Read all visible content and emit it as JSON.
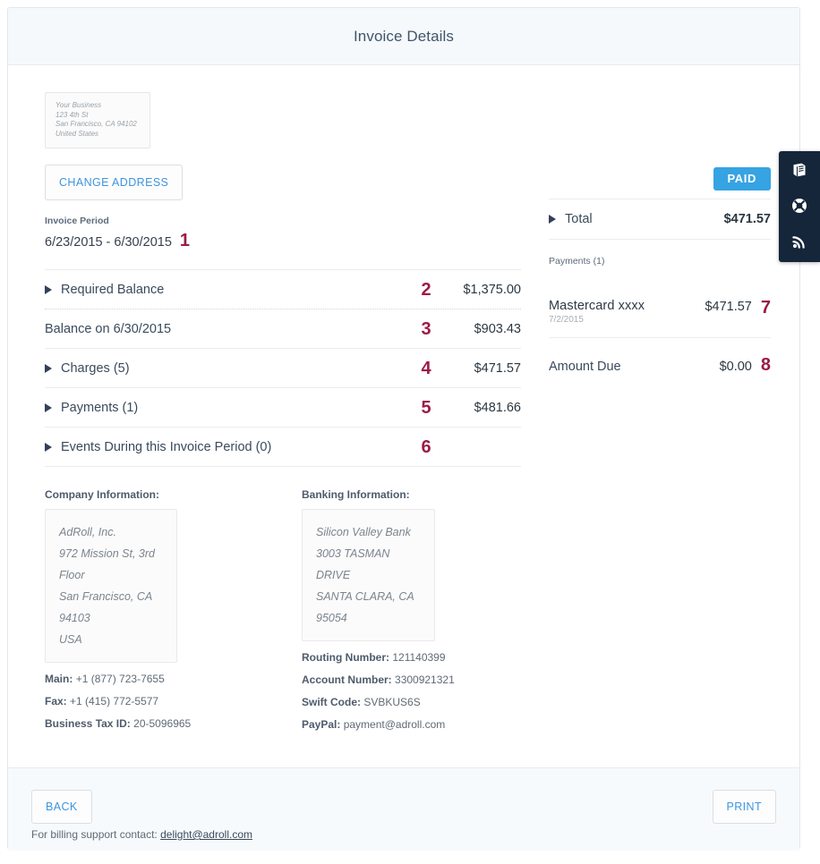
{
  "header": {
    "title": "Invoice Details"
  },
  "your_address": {
    "lines": [
      "Your Business",
      "123 4th St",
      "San Francisco, CA 94102",
      "United States"
    ],
    "change_button": "CHANGE ADDRESS"
  },
  "invoice_period": {
    "label": "Invoice Period",
    "value": "6/23/2015 - 6/30/2015",
    "annotation": "1"
  },
  "line_items": [
    {
      "label": "Required Balance",
      "amount": "$1,375.00",
      "annotation": "2",
      "caret": true,
      "divider": "dotted"
    },
    {
      "label": "Balance on 6/30/2015",
      "amount": "$903.43",
      "annotation": "3",
      "caret": false,
      "divider": "solid"
    },
    {
      "label": "Charges (5)",
      "amount": "$471.57",
      "annotation": "4",
      "caret": true,
      "divider": "solid"
    },
    {
      "label": "Payments (1)",
      "amount": "$481.66",
      "annotation": "5",
      "caret": true,
      "divider": "solid"
    },
    {
      "label": "Events During this Invoice Period (0)",
      "amount": "",
      "annotation": "6",
      "caret": true,
      "divider": "solid"
    }
  ],
  "company_information": {
    "title": "Company Information:",
    "address": [
      "AdRoll, Inc.",
      "972 Mission St, 3rd Floor",
      "San Francisco, CA 94103",
      "USA"
    ],
    "details": [
      {
        "key": "Main:",
        "value": "+1 (877) 723-7655"
      },
      {
        "key": "Fax:",
        "value": "+1 (415) 772-5577"
      },
      {
        "key": "Business Tax ID:",
        "value": "20-5096965"
      }
    ]
  },
  "banking_information": {
    "title": "Banking Information:",
    "address": [
      "Silicon Valley Bank",
      "3003 TASMAN DRIVE",
      "SANTA CLARA, CA 95054"
    ],
    "details": [
      {
        "key": "Routing Number:",
        "value": "121140399"
      },
      {
        "key": "Account Number:",
        "value": "3300921321"
      },
      {
        "key": "Swift Code:",
        "value": "SVBKUS6S"
      },
      {
        "key": "PayPal:",
        "value": "payment@adroll.com"
      }
    ]
  },
  "summary": {
    "status_badge": "PAID",
    "total_label": "Total",
    "total_amount": "$471.57",
    "payments_label": "Payments (1)",
    "payment": {
      "method": "Mastercard  xxxx",
      "date": "7/2/2015",
      "amount": "$471.57",
      "annotation": "7"
    },
    "amount_due_label": "Amount Due",
    "amount_due_value": "$0.00",
    "amount_due_annotation": "8"
  },
  "footer": {
    "back_label": "BACK",
    "print_label": "PRINT",
    "support_text": "For billing support contact:",
    "support_email": "delight@adroll.com"
  },
  "side_toolbar": {
    "items": [
      {
        "icon": "book-icon"
      },
      {
        "icon": "lifebuoy-icon"
      },
      {
        "icon": "rss-icon"
      }
    ]
  },
  "colors": {
    "accent_blue": "#36a3e3",
    "link_blue": "#3c95e0",
    "annotation_red": "#9b1b48",
    "toolbar_dark": "#15263a",
    "header_bg": "#f5f9fc"
  }
}
